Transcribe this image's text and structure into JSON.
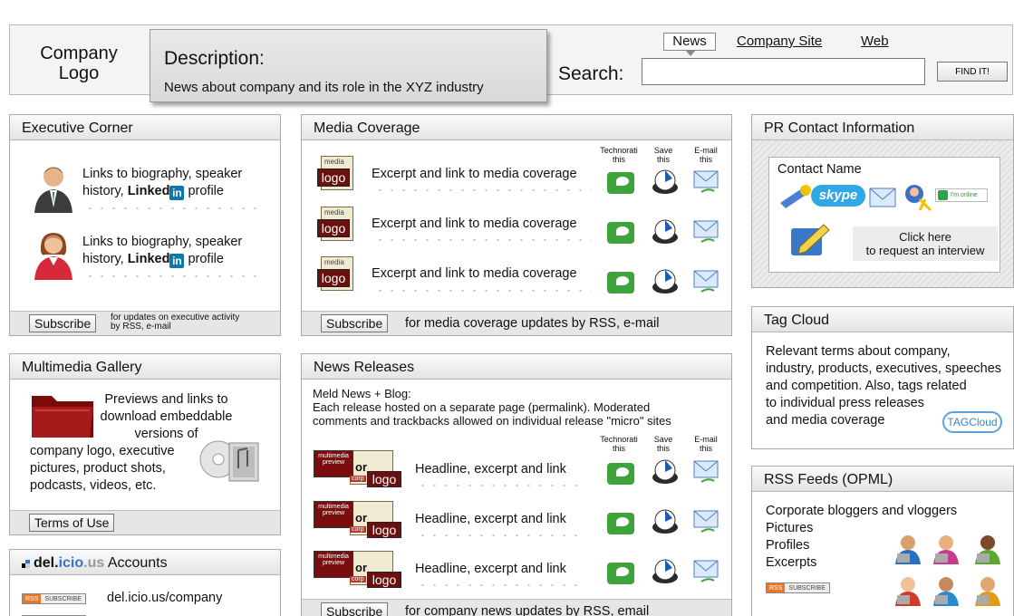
{
  "header": {
    "logo_line1": "Company",
    "logo_line2": "Logo",
    "desc_title": "Description:",
    "desc_text": "News about company and its role in the XYZ industry",
    "search_label": "Search:",
    "search_value": "",
    "find_button": "FIND IT!",
    "tabs": [
      "News",
      "Company Site",
      "Web"
    ]
  },
  "executive": {
    "title": "Executive Corner",
    "item1_line1": "Links to biography, speaker",
    "item1_line2_pre": "history,",
    "item2_line1": "Links to biography, speaker",
    "item2_line2_pre": "history,",
    "linkedin_word": "Linked",
    "linkedin_in": "in",
    "profile_word": "profile",
    "subscribe": "Subscribe",
    "foot_line1": "for updates on executive activity",
    "foot_by": "by",
    "foot_rss": "RSS",
    "foot_email": "e-mail"
  },
  "media": {
    "title": "Media Coverage",
    "col_technorati": "Technorati this",
    "col_save": "Save this",
    "col_email": "E-mail this",
    "logo_top": "media",
    "logo_label": "logo",
    "items": [
      {
        "pre": "Excerpt and",
        "link": "link",
        "post": "to media coverage"
      },
      {
        "pre": "Excerpt and",
        "link": "link",
        "post": "to media coverage"
      },
      {
        "pre": "Excerpt and",
        "link": "link",
        "post": "to media coverage"
      }
    ],
    "subscribe": "Subscribe",
    "foot_pre": "for media coverage updates by",
    "foot_rss": "RSS",
    "foot_email": "e-mail"
  },
  "pr": {
    "title": "PR Contact Information",
    "contact_name": "Contact Name",
    "skype": "skype",
    "online": "I'm online",
    "click_line1": "Click here",
    "click_line2": "to request an interview"
  },
  "gallery": {
    "title": "Multimedia Gallery",
    "line1": "Previews and links to",
    "line2": "download embeddable",
    "line3": "versions of",
    "line4": "company logo, executive",
    "line5": "pictures, product shots,",
    "line6": "podcasts, videos, etc.",
    "terms": "Terms of Use"
  },
  "news": {
    "title": "News Releases",
    "intro1": "Meld News + Blog:",
    "intro2": "Each release hosted on a separate page (permalink). Moderated",
    "intro3": "comments and trackbacks allowed on individual release \"micro\" sites",
    "col_technorati": "Technorati this",
    "col_save": "Save this",
    "col_email": "E-mail this",
    "preview_label": "multimedia preview",
    "or": "or",
    "corp": "corp",
    "logo_label": "logo",
    "items": [
      {
        "pre": "Headline, excerpt and",
        "link": "link"
      },
      {
        "pre": "Headline, excerpt and",
        "link": "link"
      },
      {
        "pre": "Headline, excerpt and",
        "link": "link"
      }
    ],
    "subscribe": "Subscribe",
    "foot_text": "for company news updates by RSS, email"
  },
  "tagcloud": {
    "title": "Tag Cloud",
    "line1": "Relevant terms about company,",
    "line2": "industry, products, executives, speeches",
    "line3": "and competition. Also, tags related",
    "line4": "to individual press releases",
    "line5": "and media coverage",
    "badge": "TAGCloud"
  },
  "rss": {
    "title": "RSS Feeds (OPML)",
    "items": [
      "Corporate bloggers and vloggers",
      "Pictures",
      "Profiles",
      "Excerpts"
    ],
    "rss_label": "RSS",
    "subscribe_label": "SUBSCRIBE"
  },
  "delicious": {
    "title_del": "del.",
    "title_icio": "icio",
    "title_us": ".us",
    "title_rest": " Accounts",
    "rss_label": "RSS",
    "subscribe_label": "SUBSCRIBE",
    "account1": "del.icio.us/company"
  },
  "colors": {
    "accent_red": "#6b0f0f",
    "linkedin_blue": "#0e76a8",
    "technorati_green": "#3ea33a"
  }
}
